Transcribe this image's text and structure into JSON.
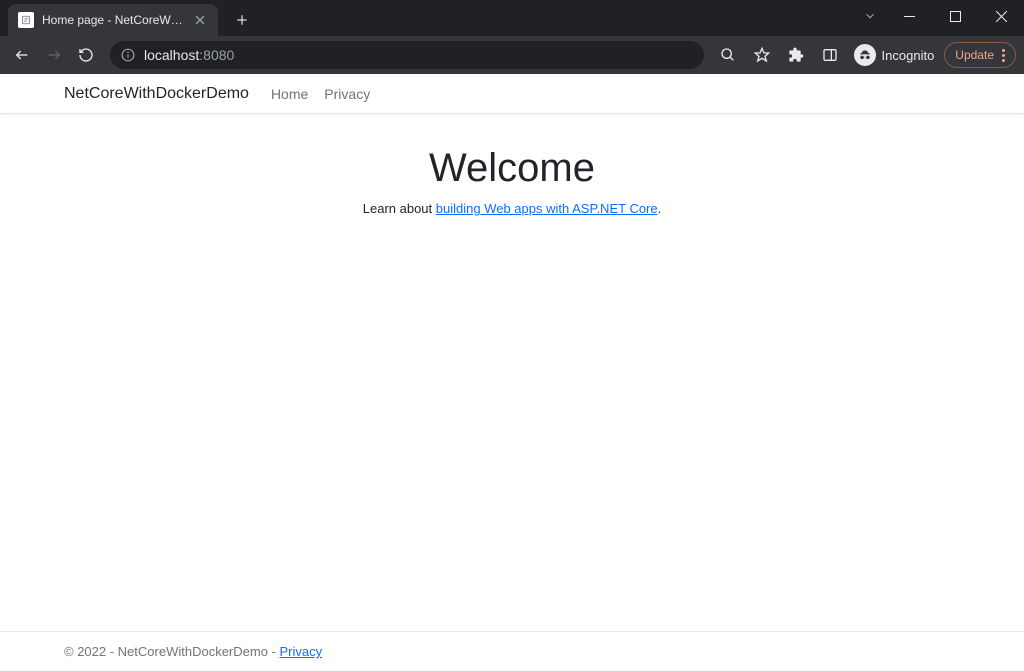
{
  "browser": {
    "tab_title": "Home page - NetCoreWithDocke",
    "address": {
      "host": "localhost",
      "port": ":8080"
    },
    "incognito_label": "Incognito",
    "update_label": "Update"
  },
  "navbar": {
    "brand": "NetCoreWithDockerDemo",
    "links": {
      "home": "Home",
      "privacy": "Privacy"
    }
  },
  "main": {
    "title": "Welcome",
    "subtitle_prefix": "Learn about ",
    "subtitle_link": "building Web apps with ASP.NET Core",
    "subtitle_suffix": "."
  },
  "footer": {
    "text": "© 2022 - NetCoreWithDockerDemo - ",
    "link": "Privacy"
  }
}
